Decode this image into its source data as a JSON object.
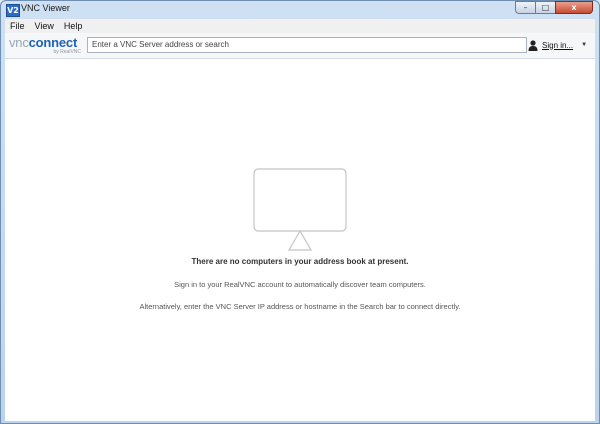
{
  "window": {
    "title": "VNC Viewer",
    "app_icon_text": "V2",
    "min_label": "–",
    "max_label": "□",
    "close_label": "x"
  },
  "menu": [
    "File",
    "View",
    "Help"
  ],
  "toolbar": {
    "logo_vnc": "vnc",
    "logo_connect": "connect",
    "logo_sub": "by RealVNC",
    "search_placeholder": "Enter a VNC Server address or search",
    "signin_label": "Sign in...",
    "signin_caret": "▼"
  },
  "empty_state": {
    "heading": "There are no computers in your address book at present.",
    "line1": "Sign in to your RealVNC account to automatically discover team computers.",
    "line2": "Alternatively, enter the VNC Server IP address or hostname in the Search bar to connect directly."
  },
  "icons": [
    "app-icon",
    "user-icon",
    "monitor-icon",
    "caret-down-icon"
  ],
  "colors": {
    "brand_blue": "#1f64b3",
    "close_red": "#c84a31",
    "titlebar": "#cfe0f3"
  }
}
